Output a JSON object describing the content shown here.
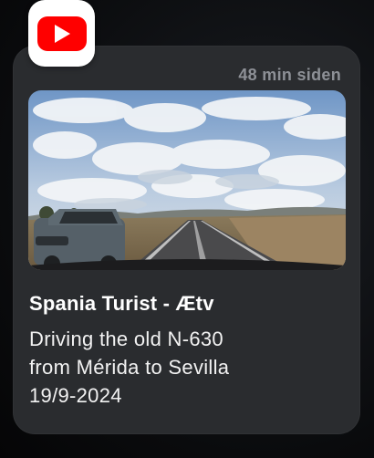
{
  "notification": {
    "app_icon": "youtube-icon",
    "timestamp": "48 min siden",
    "thumbnail": "video-thumbnail-road",
    "channel": "Spania Turist - Ætv",
    "title_lines": [
      "Driving the old N-630",
      "from Mérida to Sevilla",
      "19/9-2024"
    ]
  },
  "colors": {
    "card": "#2a2c2f",
    "youtube_red": "#ff0000",
    "timestamp": "#8d9096",
    "text": "#ffffff"
  }
}
